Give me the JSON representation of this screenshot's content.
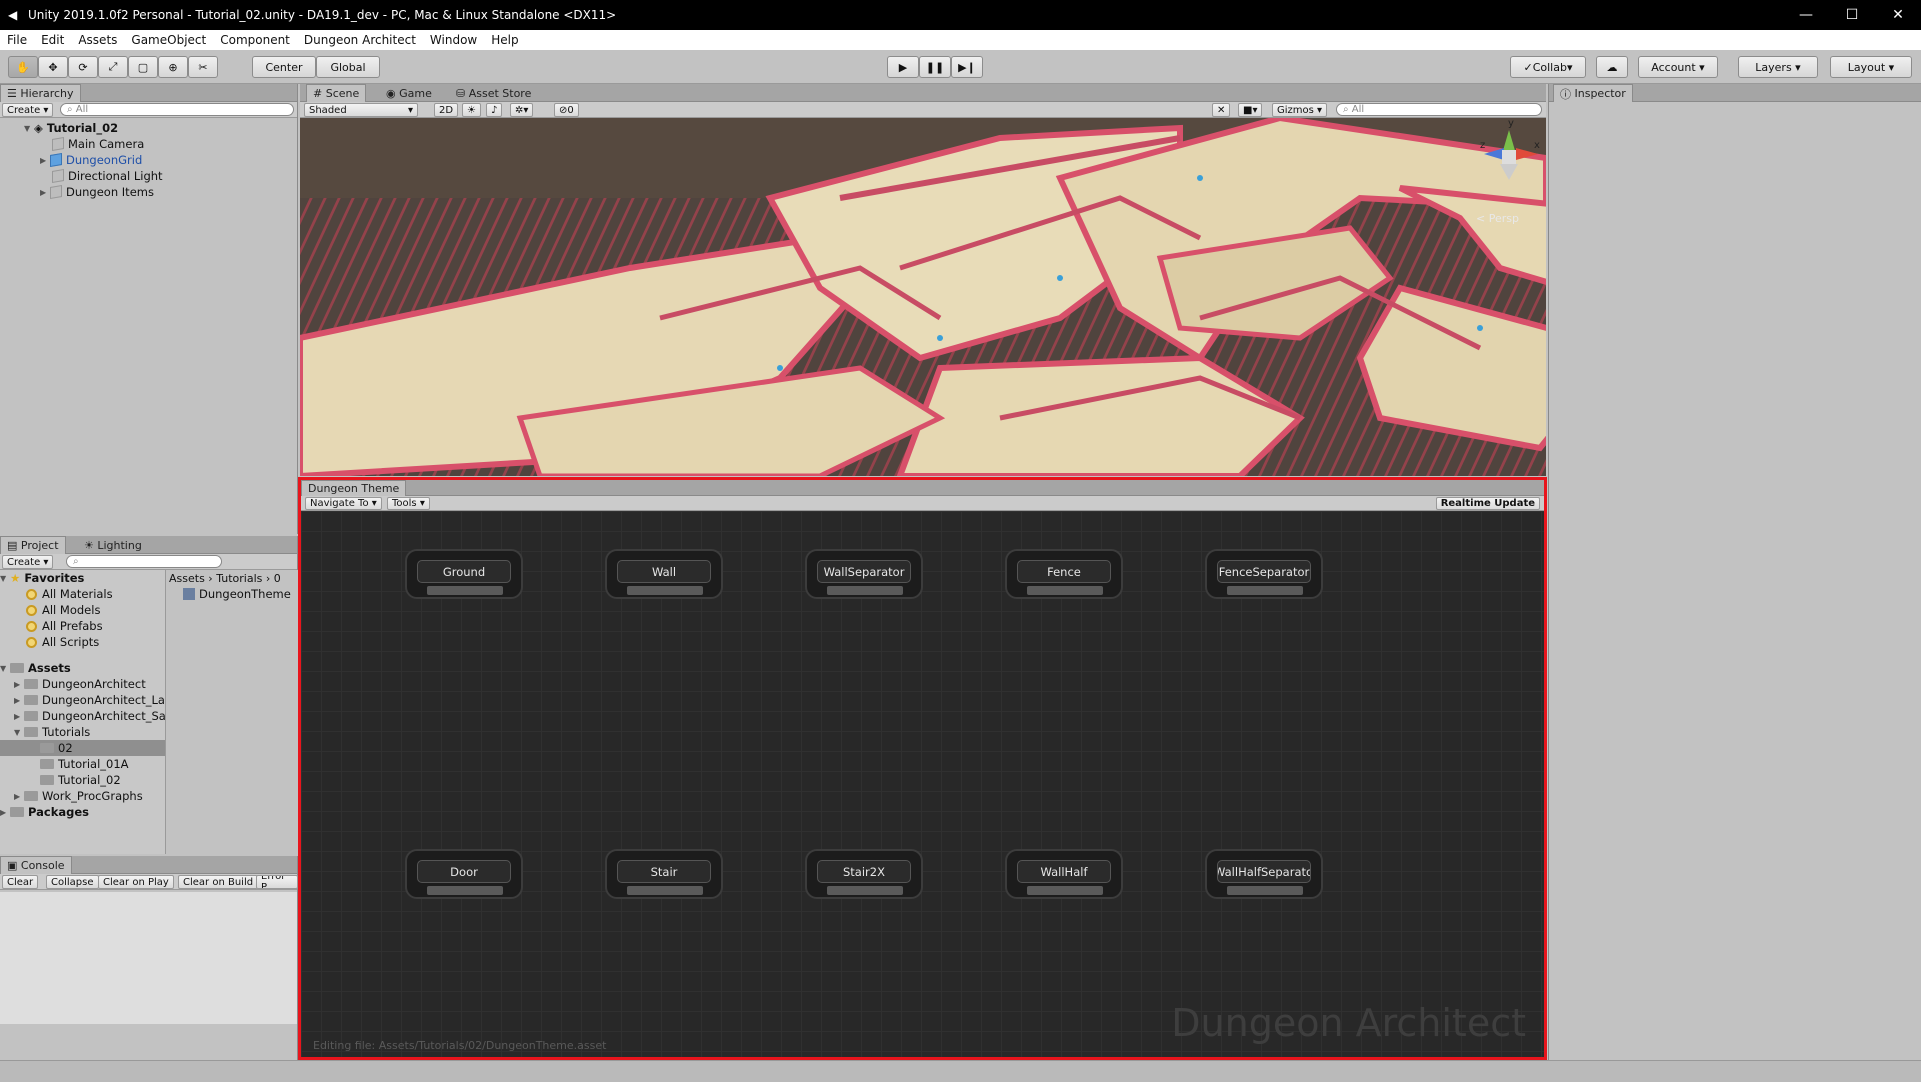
{
  "window": {
    "title": "Unity 2019.1.0f2 Personal - Tutorial_02.unity - DA19.1_dev - PC, Mac & Linux Standalone <DX11>"
  },
  "menu": [
    "File",
    "Edit",
    "Assets",
    "GameObject",
    "Component",
    "Dungeon Architect",
    "Window",
    "Help"
  ],
  "toolbar": {
    "center": "Center",
    "global": "Global",
    "collab": "Collab",
    "account": "Account",
    "layers": "Layers",
    "layout": "Layout"
  },
  "hierarchy": {
    "tab": "Hierarchy",
    "create": "Create",
    "search_placeholder": "All",
    "scene": "Tutorial_02",
    "items": [
      "Main Camera",
      "DungeonGrid",
      "Directional Light",
      "Dungeon Items"
    ]
  },
  "scene": {
    "tabs": [
      "Scene",
      "Game",
      "Asset Store"
    ],
    "shading": "Shaded",
    "mode2d": "2D",
    "fx_count": "0",
    "gizmos": "Gizmos",
    "search_placeholder": "All",
    "persp": "Persp",
    "axis_y": "y",
    "axis_x": "x",
    "axis_z": "z"
  },
  "inspector": {
    "tab": "Inspector"
  },
  "theme": {
    "tab": "Dungeon Theme",
    "navigate": "Navigate To",
    "tools": "Tools",
    "realtime": "Realtime Update",
    "nodes_top": [
      "Ground",
      "Wall",
      "WallSeparator",
      "Fence",
      "FenceSeparator"
    ],
    "nodes_bottom": [
      "Door",
      "Stair",
      "Stair2X",
      "WallHalf",
      "WallHalfSeparator"
    ],
    "watermark": "Dungeon Architect",
    "editing": "Editing file: Assets/Tutorials/02/DungeonTheme.asset",
    "highlight_color": "#e8141c"
  },
  "project": {
    "tabs": [
      "Project",
      "Lighting"
    ],
    "create": "Create",
    "favorites_label": "Favorites",
    "favorites": [
      "All Materials",
      "All Models",
      "All Prefabs",
      "All Scripts"
    ],
    "assets_label": "Assets",
    "folders": [
      "DungeonArchitect",
      "DungeonArchitect_La",
      "DungeonArchitect_Sa",
      "Tutorials",
      "02",
      "Tutorial_01A",
      "Tutorial_02",
      "Work_ProcGraphs"
    ],
    "packages": "Packages",
    "breadcrumb": [
      "Assets",
      "Tutorials",
      "0"
    ],
    "file": "DungeonTheme"
  },
  "console": {
    "tab": "Console",
    "buttons": [
      "Clear",
      "Collapse",
      "Clear on Play",
      "Clear on Build",
      "Error P."
    ]
  }
}
